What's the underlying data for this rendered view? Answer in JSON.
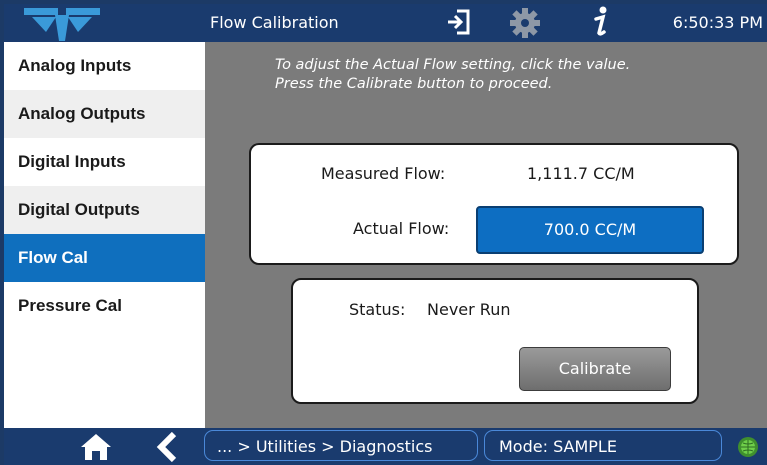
{
  "header": {
    "title": "Flow Calibration",
    "time": "6:50:33 PM",
    "icons": [
      "logo-icon",
      "exit-icon",
      "gear-icon",
      "info-icon"
    ]
  },
  "sidebar": {
    "items": [
      {
        "label": "Analog Inputs",
        "active": false
      },
      {
        "label": "Analog Outputs",
        "active": false
      },
      {
        "label": "Digital Inputs",
        "active": false
      },
      {
        "label": "Digital Outputs",
        "active": false
      },
      {
        "label": "Flow Cal",
        "active": true
      },
      {
        "label": "Pressure Cal",
        "active": false
      }
    ]
  },
  "main": {
    "instructions": [
      "To adjust the Actual Flow setting, click the value.",
      "Press the Calibrate button to proceed."
    ],
    "measured_flow_label": "Measured Flow:",
    "measured_flow_value": "1,111.7 CC/M",
    "actual_flow_label": "Actual Flow:",
    "actual_flow_value": "700.0 CC/M",
    "status_label": "Status:",
    "status_value": "Never Run",
    "calibrate_label": "Calibrate"
  },
  "footer": {
    "breadcrumb": "... > Utilities > Diagnostics",
    "mode": "Mode: SAMPLE",
    "icons": [
      "home-icon",
      "back-icon",
      "status-led-icon"
    ]
  },
  "colors": {
    "bar": "#1a3b6e",
    "accent": "#0f6fbe",
    "panel": "#7b7b7b",
    "led": "#4caf3a"
  }
}
